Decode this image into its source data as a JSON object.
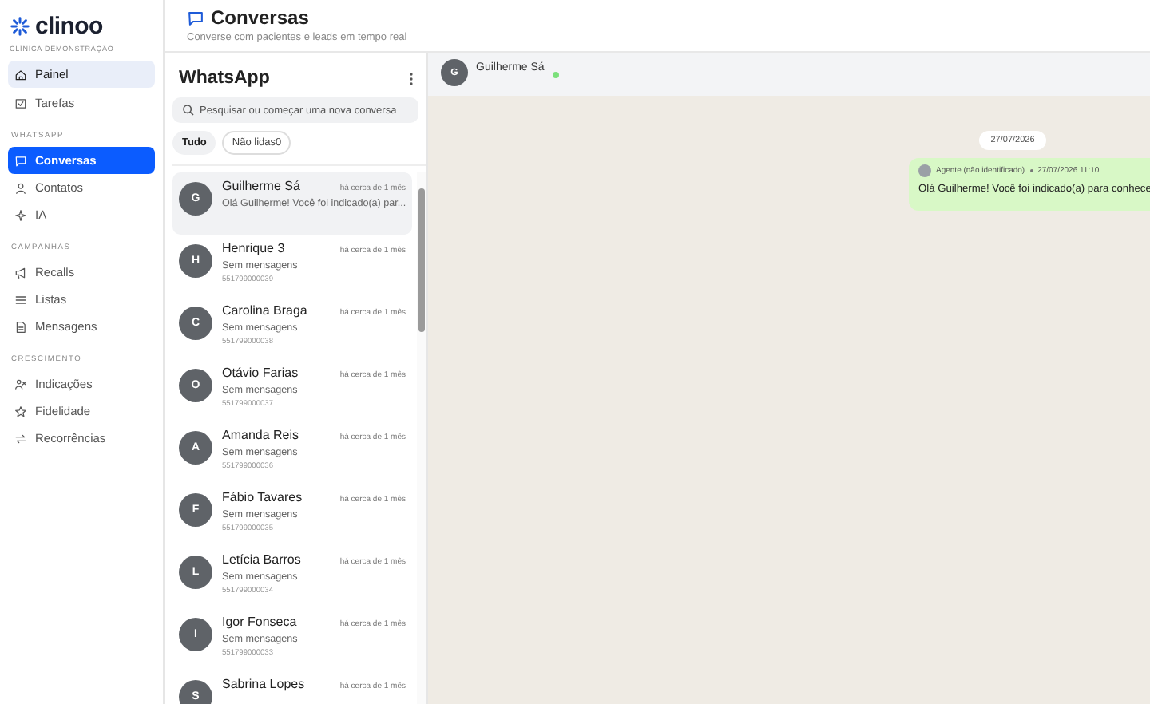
{
  "brand": {
    "name": "clinoo",
    "subtitle": "CLÍNICA DEMONSTRAÇÃO"
  },
  "sidebar": {
    "sections": [
      {
        "items": [
          {
            "label": "Painel",
            "selected": false,
            "hovered": true
          },
          {
            "label": "Tarefas",
            "selected": false,
            "hovered": false
          }
        ]
      },
      {
        "title": "WHATSAPP",
        "items": [
          {
            "label": "Conversas",
            "selected": true,
            "hovered": false
          },
          {
            "label": "Contatos",
            "selected": false,
            "hovered": false
          },
          {
            "label": "IA",
            "selected": false,
            "hovered": false
          }
        ]
      },
      {
        "title": "CAMPANHAS",
        "items": [
          {
            "label": "Recalls",
            "selected": false,
            "hovered": false
          },
          {
            "label": "Listas",
            "selected": false,
            "hovered": false
          },
          {
            "label": "Mensagens",
            "selected": false,
            "hovered": false
          }
        ]
      },
      {
        "title": "CRESCIMENTO",
        "items": [
          {
            "label": "Indicações",
            "selected": false,
            "hovered": false
          },
          {
            "label": "Fidelidade",
            "selected": false,
            "hovered": false
          },
          {
            "label": "Recorrências",
            "selected": false,
            "hovered": false
          }
        ]
      }
    ]
  },
  "page_header": {
    "title": "Conversas",
    "subtitle": "Converse com pacientes e leads em tempo real"
  },
  "conversation_list": {
    "title": "WhatsApp",
    "search": {
      "placeholder": "Pesquisar ou começar uma nova conversa"
    },
    "filters": [
      {
        "label": "Tudo",
        "selected": true
      },
      {
        "label": "Não lidas",
        "count": "0",
        "selected": false
      }
    ],
    "items": [
      {
        "initial": "G",
        "name": "Guilherme Sá",
        "time": "há cerca de 1 mês",
        "preview": "Olá Guilherme! Você foi indicado(a) par...",
        "selected": true
      },
      {
        "initial": "H",
        "name": "Henrique 3",
        "time": "há cerca de 1 mês",
        "preview": "Sem mensagens",
        "phone": "551799000039",
        "selected": false
      },
      {
        "initial": "C",
        "name": "Carolina Braga",
        "time": "há cerca de 1 mês",
        "preview": "Sem mensagens",
        "phone": "551799000038",
        "selected": false
      },
      {
        "initial": "O",
        "name": "Otávio Farias",
        "time": "há cerca de 1 mês",
        "preview": "Sem mensagens",
        "phone": "551799000037",
        "selected": false
      },
      {
        "initial": "A",
        "name": "Amanda Reis",
        "time": "há cerca de 1 mês",
        "preview": "Sem mensagens",
        "phone": "551799000036",
        "selected": false
      },
      {
        "initial": "F",
        "name": "Fábio Tavares",
        "time": "há cerca de 1 mês",
        "preview": "Sem mensagens",
        "phone": "551799000035",
        "selected": false
      },
      {
        "initial": "L",
        "name": "Letícia Barros",
        "time": "há cerca de 1 mês",
        "preview": "Sem mensagens",
        "phone": "551799000034",
        "selected": false
      },
      {
        "initial": "I",
        "name": "Igor Fonseca",
        "time": "há cerca de 1 mês",
        "preview": "Sem mensagens",
        "phone": "551799000033",
        "selected": false
      },
      {
        "initial": "S",
        "name": "Sabrina Lopes",
        "time": "há cerca de 1 mês",
        "selected": false
      }
    ]
  },
  "chat": {
    "contact": {
      "initial": "G",
      "name": "Guilherme Sá",
      "online": true
    },
    "date": "27/07/2026",
    "messages": [
      {
        "sender": "Agente (não identificado)",
        "time": "27/07/2026 11:10",
        "text": "Olá Guilherme! Você foi indicado(a) para conhece"
      }
    ]
  }
}
